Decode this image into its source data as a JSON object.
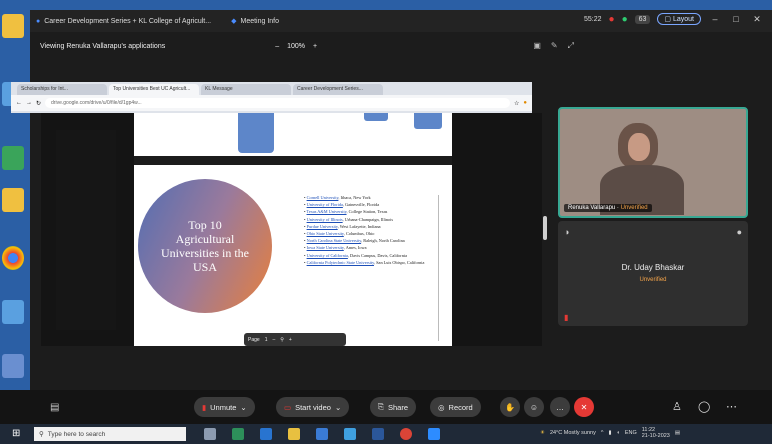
{
  "zoom_window": {
    "title": "Career Development Series + KL College of Agricult...",
    "meeting_tab": "Meeting Info",
    "time": "55:22",
    "participants_count": "63",
    "layout_label": "Layout"
  },
  "share_bar": {
    "viewing_label": "Viewing Renuka Vallarapu's applications",
    "zoom_level": "100%"
  },
  "browser": {
    "tabs": [
      "Scholarships for Int...",
      "Top Universities Best UC Agricult...",
      "KL Message",
      "Career Development Series..."
    ],
    "url": "drive.google.com/drive/u/0/file/d/1gp4w..."
  },
  "slide": {
    "circle_title": "Top 10 Agricultural Universities in the USA",
    "universities": [
      {
        "name": "Cornell University",
        "location": "Ithaca, New York"
      },
      {
        "name": "University of Florida",
        "location": "Gainesville, Florida"
      },
      {
        "name": "Texas A&M University",
        "location": "College Station, Texas"
      },
      {
        "name": "University of Illinois",
        "location": "Urbana-Champaign, Illinois"
      },
      {
        "name": "Purdue University",
        "location": "West Lafayette, Indiana"
      },
      {
        "name": "Ohio State University",
        "location": "Columbus, Ohio"
      },
      {
        "name": "North Carolina State University",
        "location": "Raleigh, North Carolina"
      },
      {
        "name": "Iowa State University",
        "location": "Ames, Iowa"
      },
      {
        "name": "University of California",
        "location": "Davis Campus, Davis, California"
      },
      {
        "name": "California Polytechnic State University",
        "location": "San Luis Obispo, California"
      }
    ],
    "page_label": "Page",
    "page_number": "1"
  },
  "participants": {
    "p1_name": "Renuka Vallarapu",
    "p1_status": "Unverified",
    "p2_name": "Dr. Uday Bhaskar",
    "p2_status": "Unverified"
  },
  "toolbar": {
    "unmute": "Unmute",
    "start_video": "Start video",
    "share": "Share",
    "record": "Record"
  },
  "taskbar": {
    "search_placeholder": "Type here to search",
    "weather": "24°C Mostly sunny",
    "lang": "ENG",
    "time": "11:22",
    "date": "21-10-2023"
  },
  "colors": {
    "accent_teal": "#38a893",
    "leave_red": "#e53935",
    "link_blue": "#1d4fb8"
  }
}
